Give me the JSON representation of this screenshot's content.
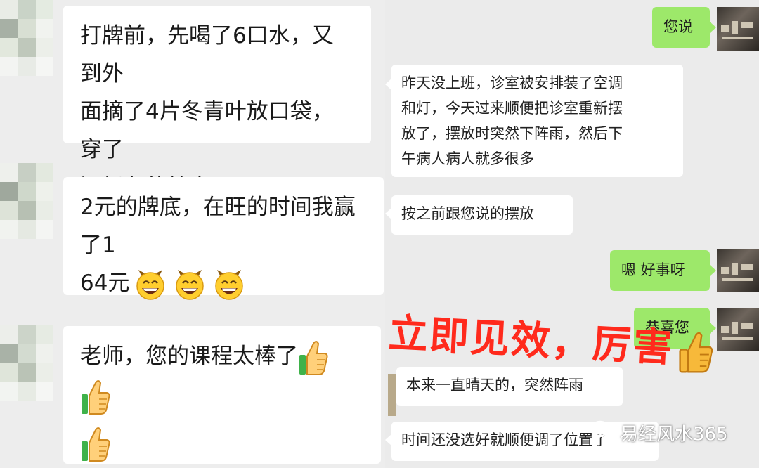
{
  "left_chat": {
    "messages": [
      {
        "lines": [
          "打牌前，先喝了6口水，又到外",
          "面摘了4片冬青叶放口袋，穿了",
          "深绿色的棉衣"
        ]
      },
      {
        "lines": [
          "2元的牌底，在旺的时间我赢了1",
          "64元"
        ],
        "emoji": [
          "grinning-emoji",
          "grinning-emoji",
          "grinning-emoji"
        ]
      },
      {
        "lines": [
          "老师，您的课程太棒了"
        ],
        "emoji": [
          "thumbs-up-emoji",
          "thumbs-up-emoji",
          "thumbs-up-emoji"
        ]
      }
    ]
  },
  "right_chat": {
    "messages": [
      {
        "from": "me",
        "text": "您说"
      },
      {
        "from": "other",
        "lines": [
          "昨天没上班，诊室被安排装了空调",
          "和灯，今天过来顺便把诊室重新摆",
          "放了，摆放时突然下阵雨，然后下",
          "午病人病人就多很多"
        ]
      },
      {
        "from": "other",
        "text": "按之前跟您说的摆放"
      },
      {
        "from": "me",
        "text": "嗯 好事呀"
      },
      {
        "from": "me",
        "text": "恭喜您"
      },
      {
        "from": "other",
        "text": "本来一直晴天的，突然阵雨"
      },
      {
        "from": "other",
        "text": "时间还没选好就顺便调了位置了"
      }
    ]
  },
  "overlay": {
    "text": "立即见效，厉害",
    "color": "#ff2a1c"
  },
  "watermark": {
    "text": "易经风水365"
  },
  "colors": {
    "sent_bubble": "#9de86a",
    "received_bubble": "#ffffff",
    "background": "#ececec"
  }
}
